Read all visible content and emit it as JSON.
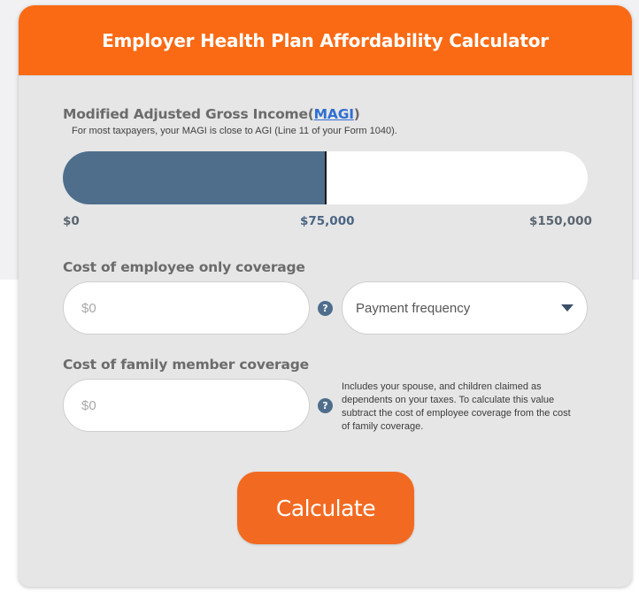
{
  "header": {
    "title": "Employer Health Plan Affordability Calculator"
  },
  "income": {
    "label": "Modified Adjusted Gross Income(",
    "link_text": "MAGI",
    "label_suffix": ")",
    "hint": "For most taxpayers, your MAGI is close to AGI (Line 11 of your Form 1040).",
    "slider": {
      "min": 0,
      "max": 150000,
      "value": 75000,
      "min_label": "$0",
      "value_label": "$75,000",
      "max_label": "$150,000"
    }
  },
  "employee_coverage": {
    "label": "Cost of employee only coverage",
    "placeholder": "$0",
    "help_symbol": "?",
    "frequency": {
      "placeholder": "Payment frequency"
    }
  },
  "family_coverage": {
    "label": "Cost of family member coverage",
    "placeholder": "$0",
    "help_symbol": "?",
    "note": "Includes your spouse, and children claimed as dependents on your taxes. To calculate this value subtract the cost of employee coverage from the cost of family coverage."
  },
  "actions": {
    "calculate_label": "Calculate"
  },
  "colors": {
    "header_bg": "#fa6a14",
    "button_bg": "#f26a21",
    "slider_fill": "#4e6e8c",
    "link": "#2f6fd3",
    "card_bg": "#e6e6e6"
  },
  "icons": {
    "help": "question-circle-icon",
    "dropdown": "chevron-down-icon"
  }
}
